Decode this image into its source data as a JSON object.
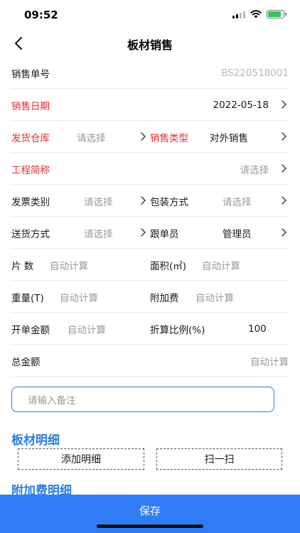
{
  "status_bar": {
    "time": "09:52",
    "battery_level": 0.85
  },
  "nav": {
    "title": "板材销售"
  },
  "form": {
    "order_no": {
      "label": "销售单号",
      "value": "BS220518001"
    },
    "sale_date": {
      "label": "销售日期",
      "value": "2022-05-18"
    },
    "warehouse": {
      "label": "发货仓库",
      "placeholder": "请选择"
    },
    "sale_type": {
      "label": "销售类型",
      "value": "对外销售"
    },
    "project": {
      "label": "工程简称",
      "placeholder": "请选择"
    },
    "invoice_type": {
      "label": "发票类别",
      "placeholder": "请选择"
    },
    "packing": {
      "label": "包装方式",
      "placeholder": "请选择"
    },
    "delivery": {
      "label": "送货方式",
      "placeholder": "请选择"
    },
    "follower": {
      "label": "跟单员",
      "value": "管理员"
    },
    "pieces": {
      "label": "片 数",
      "value": "自动计算"
    },
    "area": {
      "label": "面积(㎡)",
      "value": "自动计算"
    },
    "weight": {
      "label": "重量(T)",
      "value": "自动计算"
    },
    "extra_fee": {
      "label": "附加费",
      "value": "自动计算"
    },
    "bill_amount": {
      "label": "开单金额",
      "value": "自动计算"
    },
    "discount": {
      "label": "折算比例(%)",
      "value": "100"
    },
    "total": {
      "label": "总金额",
      "value": "自动计算"
    }
  },
  "remark": {
    "placeholder": "请输入备注"
  },
  "detail_section": {
    "title": "板材明细",
    "add_label": "添加明细",
    "scan_label": "扫一扫"
  },
  "extra_section": {
    "title": "附加费明细"
  },
  "save_label": "保存",
  "colors": {
    "accent": "#2f7cf6",
    "required": "#e52e2e"
  }
}
